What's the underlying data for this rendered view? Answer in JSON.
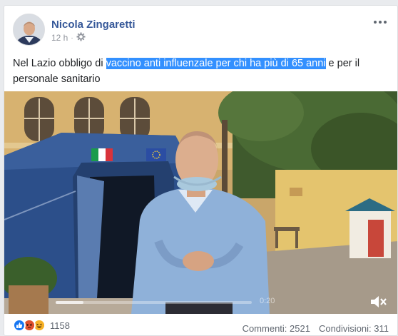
{
  "post": {
    "author": "Nicola Zingaretti",
    "time": "12 h",
    "privacy_icon": "gear-globe-icon",
    "more_icon": "more-dots-icon",
    "text_before": "Nel Lazio obbligo di ",
    "text_highlight": "vaccino anti influenzale per chi ha più di 65 anni",
    "text_after": " e per il personale sanitario"
  },
  "video": {
    "time": "0:20",
    "progress": 0.14,
    "mute_icon": "speaker-muted-icon"
  },
  "footer": {
    "reaction_icons": [
      "like-icon",
      "angry-icon",
      "haha-icon"
    ],
    "reaction_count": "1158",
    "comments": "Commenti: 2521",
    "shares": "Condivisioni: 311"
  },
  "colors": {
    "author": "#365899",
    "highlight": "#3390ff",
    "like": "#1877f2",
    "angry": "#e9710f",
    "haha": "#f7b125"
  }
}
